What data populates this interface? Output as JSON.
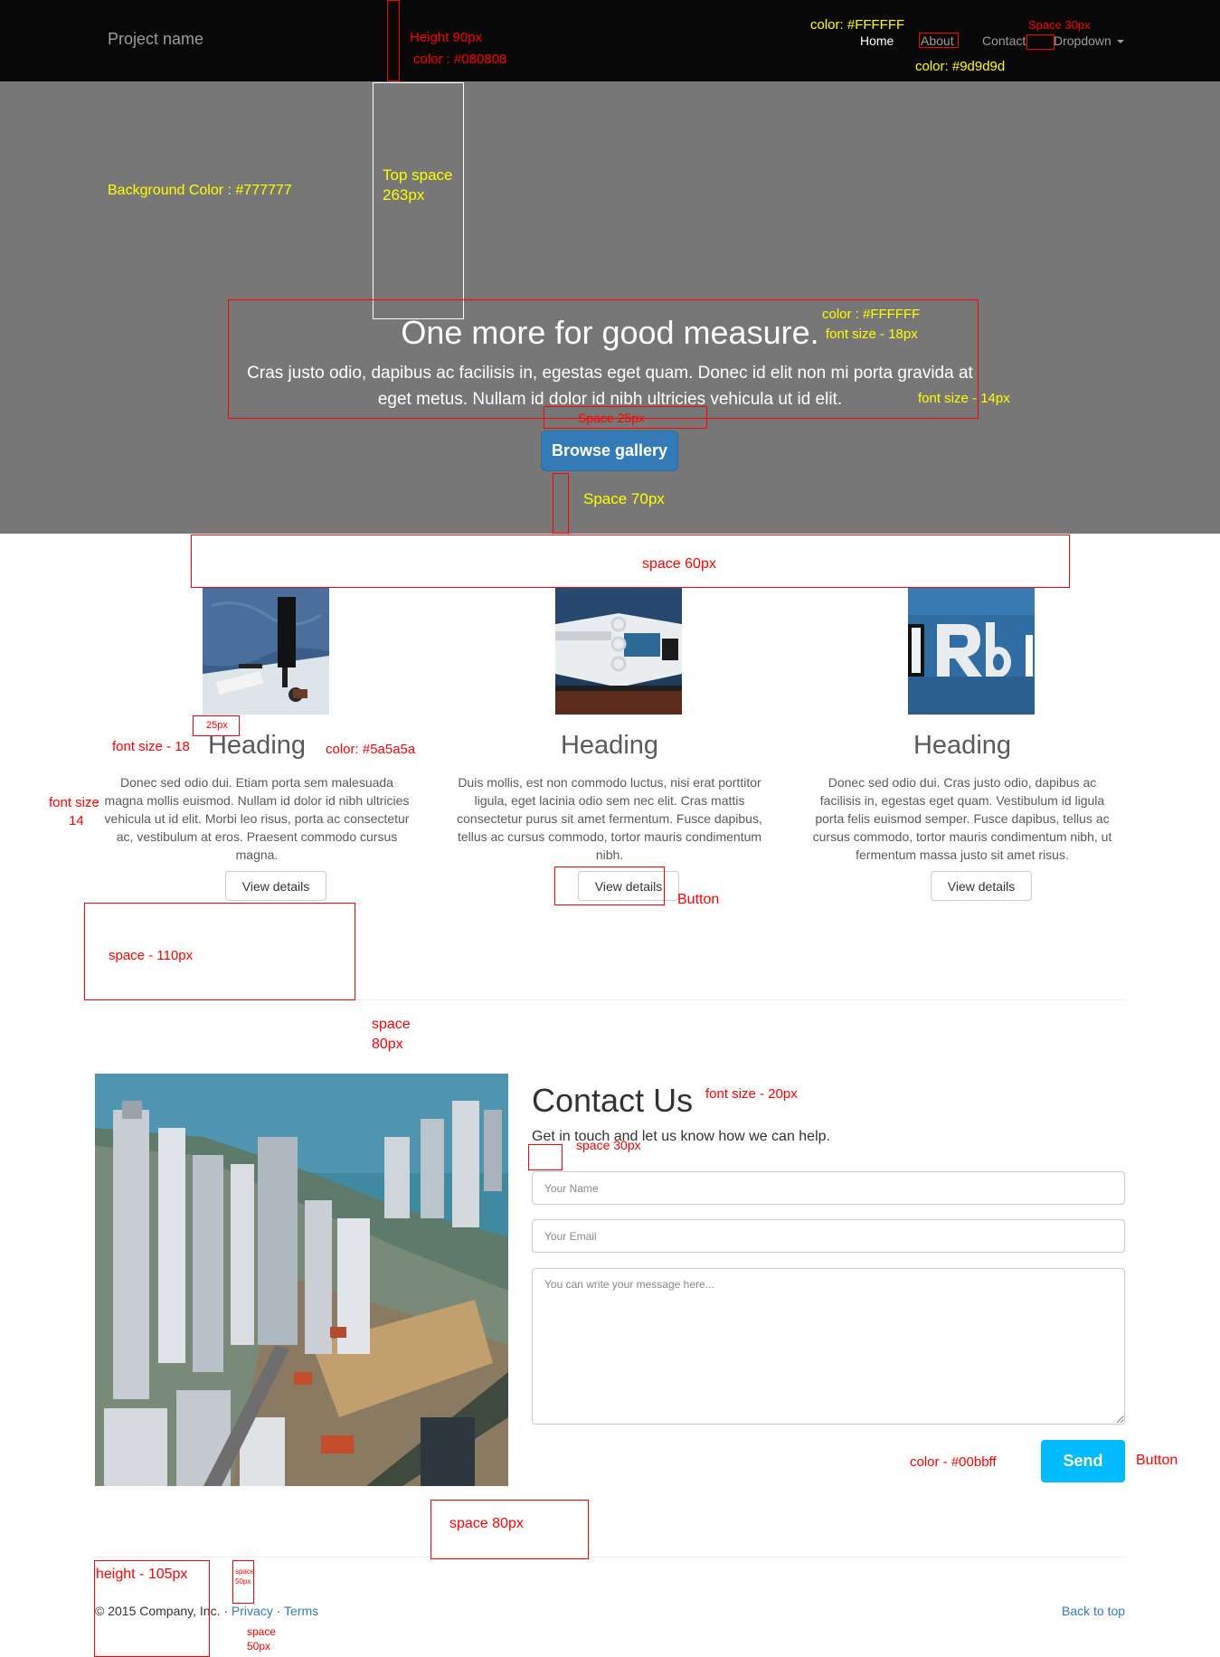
{
  "navbar": {
    "brand": "Project name",
    "items": [
      {
        "label": "Home",
        "active": true
      },
      {
        "label": "About",
        "active": false
      },
      {
        "label": "Contact",
        "active": false
      },
      {
        "label": "Dropdown",
        "active": false,
        "dropdown": true
      }
    ],
    "background_color": "#080808",
    "link_color": "#9d9d9d",
    "active_color": "#FFFFFF"
  },
  "hero": {
    "title": "One more for good measure.",
    "text": "Cras justo odio, dapibus ac facilisis in, egestas eget quam. Donec id elit non mi porta gravida at eget metus. Nullam id dolor id nibh ultricies vehicula ut id elit.",
    "button_label": "Browse gallery",
    "background_color": "#777777"
  },
  "features": [
    {
      "heading": "Heading",
      "text": "Donec sed odio dui. Etiam porta sem malesuada magna mollis euismod. Nullam id dolor id nibh ultricies vehicula ut id elit. Morbi leo risus, porta ac consectetur ac, vestibulum at eros. Praesent commodo cursus magna.",
      "button_label": "View details"
    },
    {
      "heading": "Heading",
      "text": "Duis mollis, est non commodo luctus, nisi erat porttitor ligula, eget lacinia odio sem nec elit. Cras mattis consectetur purus sit amet fermentum. Fusce dapibus, tellus ac cursus commodo, tortor mauris condimentum nibh.",
      "button_label": "View details"
    },
    {
      "heading": "Heading",
      "text": "Donec sed odio dui. Cras justo odio, dapibus ac facilisis in, egestas eget quam. Vestibulum id ligula porta felis euismod semper. Fusce dapibus, tellus ac cursus commodo, tortor mauris condimentum nibh, ut fermentum massa justo sit amet risus.",
      "button_label": "View details"
    }
  ],
  "contact": {
    "title": "Contact Us",
    "subtitle": "Get in touch and let us know how we can help.",
    "name_placeholder": "Your Name",
    "email_placeholder": "Your Email",
    "message_placeholder": "You can write your message here...",
    "send_label": "Send",
    "send_color": "#00bbff"
  },
  "footer": {
    "copyright": "© 2015 Company, Inc.",
    "separator": "·",
    "privacy": "Privacy",
    "terms": "Terms",
    "back_to_top": "Back to top"
  },
  "annotations": {
    "height_90": "Height 90px",
    "navbar_color": "color : #080808",
    "color_white_nav": "color: #FFFFFF",
    "space_30_nav": "Space 30px",
    "color_9d": "color: #9d9d9d",
    "bg_color": "Background Color : #777777",
    "top_space_1": "Top space",
    "top_space_2": "263px",
    "hero_color": "color : #FFFFFF",
    "font_18": "font size - 18px",
    "font_14": "font size - 14px",
    "space_25": "Space 25px",
    "space_70": "Space 70px",
    "space_60": "space 60px",
    "px25": "25px",
    "font_size_18": "font size - 18",
    "color_5a": "color: #5a5a5a",
    "font_size_14_a": "font size",
    "font_size_14_b": "14",
    "button": "Button",
    "space_110": "space - 110px",
    "space_80_a": "space",
    "space_80_b": "80px",
    "font_20": "font size - 20px",
    "space_30": "space 30px",
    "color_00bbff": "color - #00bbff",
    "button2": "Button",
    "space_80": "space 80px",
    "height_105": "height - 105px",
    "space_50_small_a": "space",
    "space_50_small_b": "50px",
    "space_50_a": "space",
    "space_50_b": "50px"
  }
}
